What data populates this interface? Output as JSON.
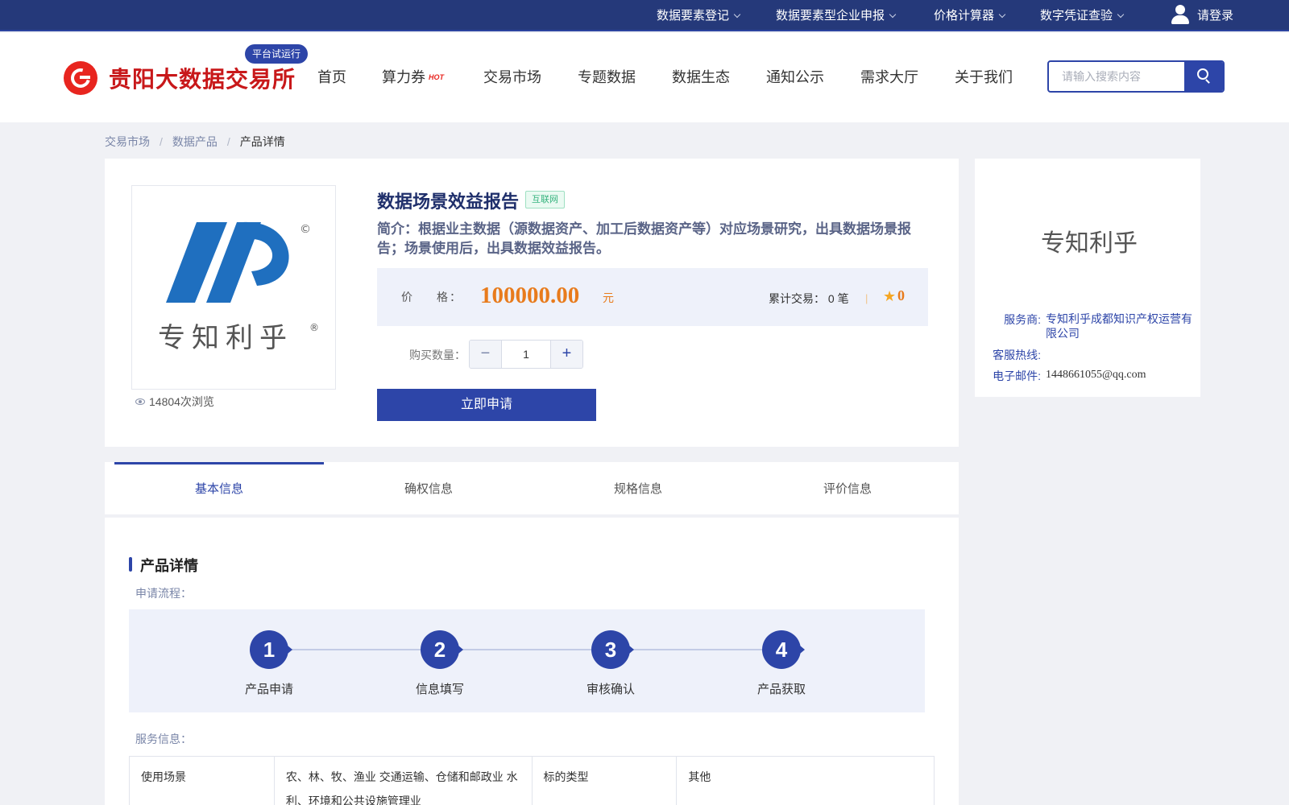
{
  "topbar": {
    "items": [
      {
        "label": "数据要素登记"
      },
      {
        "label": "数据要素型企业申报"
      },
      {
        "label": "价格计算器"
      },
      {
        "label": "数字凭证查验"
      }
    ],
    "login_label": "请登录",
    "background_color": "#25397a"
  },
  "header": {
    "site_name": "贵阳大数据交易所",
    "trial_badge": "平台试运行",
    "hot_badge": "HOT",
    "nav": [
      {
        "label": "首页"
      },
      {
        "label": "算力券"
      },
      {
        "label": "交易市场"
      },
      {
        "label": "专题数据"
      },
      {
        "label": "数据生态"
      },
      {
        "label": "通知公示"
      },
      {
        "label": "需求大厅"
      },
      {
        "label": "关于我们"
      }
    ],
    "search_placeholder": "请输入搜索内容",
    "brand_color": "#c8181a",
    "accent_color": "#2d45a8"
  },
  "breadcrumb": {
    "items": [
      {
        "label": "交易市场"
      },
      {
        "label": "数据产品"
      },
      {
        "label": "产品详情"
      }
    ]
  },
  "product": {
    "title": "数据场景效益报告",
    "tag": "互联网",
    "intro": "简介：根据业主数据（源数据资产、加工后数据资产等）对应场景研究，出具数据场景报告；场景使用后，出具数据效益报告。",
    "price_label": "价 格：",
    "price": "100000.00",
    "price_unit": "元",
    "trade_count": "累计交易： 0 笔",
    "divider": "|",
    "rating": "0",
    "views": "14804次浏览",
    "image_text": "专知利乎",
    "qty_label": "购买数量：",
    "qty_value": "1",
    "apply_label": "立即申请",
    "price_color": "#e87b1c"
  },
  "vendor": {
    "logo_text": "专知利乎",
    "provider_key": "服务商:",
    "provider_value": "专知利乎成都知识产权运营有限公司",
    "hotline_key": "客服热线:",
    "hotline_value": "",
    "email_key": "电子邮件:",
    "email_value": "1448661055@qq.com"
  },
  "tabs": [
    {
      "label": "基本信息",
      "active": true
    },
    {
      "label": "确权信息",
      "active": false
    },
    {
      "label": "规格信息",
      "active": false
    },
    {
      "label": "评价信息",
      "active": false
    }
  ],
  "detail": {
    "section_title": "产品详情",
    "flow_label": "申请流程：",
    "steps": [
      {
        "num": "1",
        "label": "产品申请"
      },
      {
        "num": "2",
        "label": "信息填写"
      },
      {
        "num": "3",
        "label": "审核确认"
      },
      {
        "num": "4",
        "label": "产品获取"
      }
    ],
    "service_label": "服务信息：",
    "table": [
      {
        "k1": "使用场景",
        "v1": "农、林、牧、渔业 交通运输、仓储和邮政业 水利、环境和公共设施管理业",
        "k2": "标的类型",
        "v2": "其他"
      }
    ]
  }
}
